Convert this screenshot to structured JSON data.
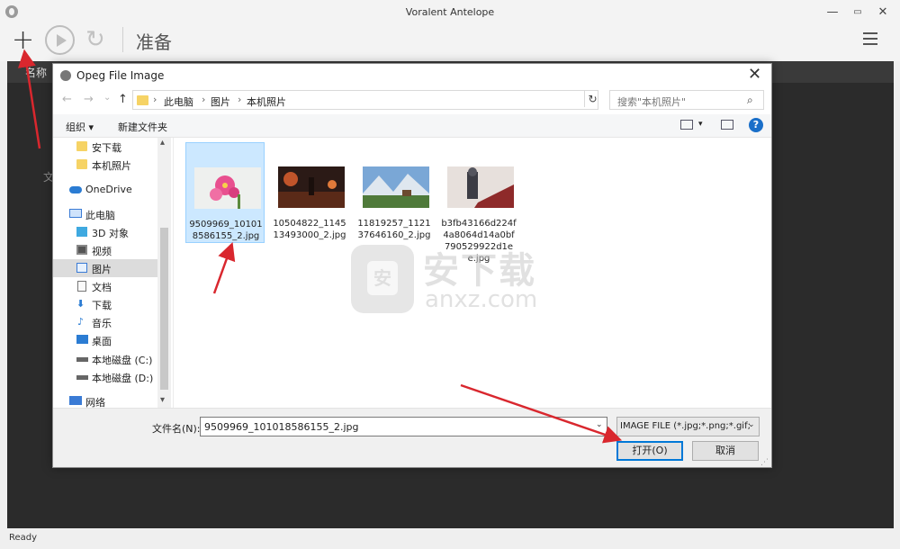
{
  "app": {
    "title": "Voralent Antelope",
    "window_controls": {
      "minimize": "—",
      "maximize": "▭",
      "close": "✕"
    },
    "toolbar": {
      "add": "+",
      "refresh": "↻",
      "status": "准备"
    },
    "main": {
      "column_name": "名称",
      "hint": "文"
    },
    "statusbar": "Ready"
  },
  "dialog": {
    "title": "Opeg File Image",
    "close": "✕",
    "nav": {
      "back": "←",
      "forward": "→",
      "dropdown": "⌄",
      "up": "↑"
    },
    "breadcrumb": [
      "此电脑",
      "图片",
      "本机照片"
    ],
    "breadcrumb_sep": "›",
    "address_dropdown": "⌄",
    "address_refresh": "↻",
    "search": {
      "placeholder": "搜索\"本机照片\"",
      "icon": "⌕"
    },
    "commands": {
      "organize": "组织 ▾",
      "new_folder": "新建文件夹",
      "view_menu": "▾",
      "help": "?"
    },
    "nav_pane": [
      {
        "label": "安下载",
        "icon": "folder-icon"
      },
      {
        "label": "本机照片",
        "icon": "folder-icon"
      },
      {
        "label": "OneDrive",
        "icon": "cloud-icon"
      },
      {
        "label": "此电脑",
        "icon": "computer-icon"
      },
      {
        "label": "3D 对象",
        "icon": "cube-icon"
      },
      {
        "label": "视频",
        "icon": "video-icon"
      },
      {
        "label": "图片",
        "icon": "pictures-icon",
        "selected": true
      },
      {
        "label": "文档",
        "icon": "document-icon"
      },
      {
        "label": "下载",
        "icon": "download-icon"
      },
      {
        "label": "音乐",
        "icon": "music-icon"
      },
      {
        "label": "桌面",
        "icon": "desktop-icon"
      },
      {
        "label": "本地磁盘 (C:)",
        "icon": "drive-icon"
      },
      {
        "label": "本地磁盘 (D:)",
        "icon": "drive-icon"
      },
      {
        "label": "网络",
        "icon": "network-icon"
      }
    ],
    "nav_scroll": {
      "up": "▴",
      "down": "▾"
    },
    "files": [
      {
        "name": "9509969_101018586155_2.jpg",
        "selected": true,
        "thumb_colors": [
          "#f1f1f1",
          "#e74c8b"
        ]
      },
      {
        "name": "10504822_114513493000_2.jpg",
        "selected": false,
        "thumb_colors": [
          "#2b1a16",
          "#c0542a"
        ]
      },
      {
        "name": "11819257_112137646160_2.jpg",
        "selected": false,
        "thumb_colors": [
          "#7aa7d6",
          "#4f7a3a"
        ]
      },
      {
        "name": "b3fb43166d224f4a8064d14a0bf790529922d1ee.jpg",
        "selected": false,
        "thumb_colors": [
          "#e7e0dc",
          "#8e2a2a"
        ]
      }
    ],
    "footer": {
      "filename_label": "文件名(N):",
      "filename_value": "9509969_101018586155_2.jpg",
      "filename_dropdown": "⌄",
      "file_type": "IMAGE FILE (*.jpg;*.png;*.gif;",
      "file_type_dropdown": "⌄",
      "open_button": "打开(O)",
      "cancel_button": "取消",
      "grip": "⋰"
    }
  },
  "watermark": {
    "cn": "安下载",
    "en": "anxz.com",
    "shield": "安"
  },
  "colors": {
    "accent": "#0078d7",
    "selection": "#cce8ff",
    "arrow": "#d9272e",
    "app_dark": "#2b2b2b"
  }
}
